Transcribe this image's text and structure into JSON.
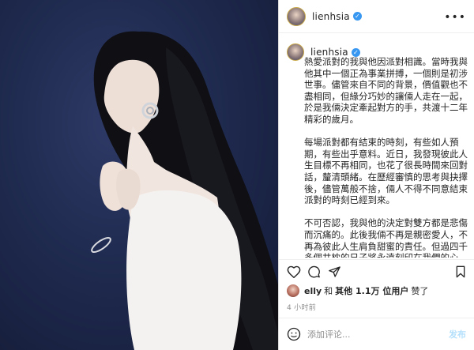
{
  "post": {
    "username": "lienhsia",
    "verified_icon": "verified-badge-icon",
    "caption_username": "lienhsia",
    "caption_paragraphs": [
      "熱愛派對的我與他因派對相識。當時我與他其中一個正為事業拼搏，一個則是初涉世事。儘管來自不同的背景，價值觀也不盡相同，但緣分巧妙的讓倆人走在一起，於是我倆決定牽起對方的手，共渡十二年精彩的歲月。",
      "每場派對都有結束的時刻，有些如人預期，有些出乎意料。近日，我發現彼此人生目標不再相同，也花了很長時間來回對話，釐清頭緒。在歷經審慎的思考與抉擇後，儘管萬般不捨，倆人不得不同意結束派對的時刻已經到來。",
      "不可否認，我與他的決定對雙方都是悲傷而沉痛的。此後我倆不再是親密愛人，不再為彼此人生肩負甜蜜的責任。但過四千多個共枕的日子將永遠刻印在我們的心上，我與他共享許多不足為外"
    ],
    "likes": {
      "first_user": "elly",
      "and": "和",
      "others": "其他 1.1万 位用户",
      "liked": "赞了"
    },
    "time_ago": "4 小时前",
    "comment_placeholder": "添加评论...",
    "post_button": "发布"
  },
  "colors": {
    "verified": "#3897f0",
    "text": "#262626",
    "muted": "#8e8e8e",
    "photo_bg": "#1f2a4f"
  },
  "icons": {
    "like": "heart-icon",
    "comment": "comment-icon",
    "share": "share-icon",
    "save": "bookmark-icon",
    "more": "more-icon",
    "emoji": "emoji-icon"
  }
}
